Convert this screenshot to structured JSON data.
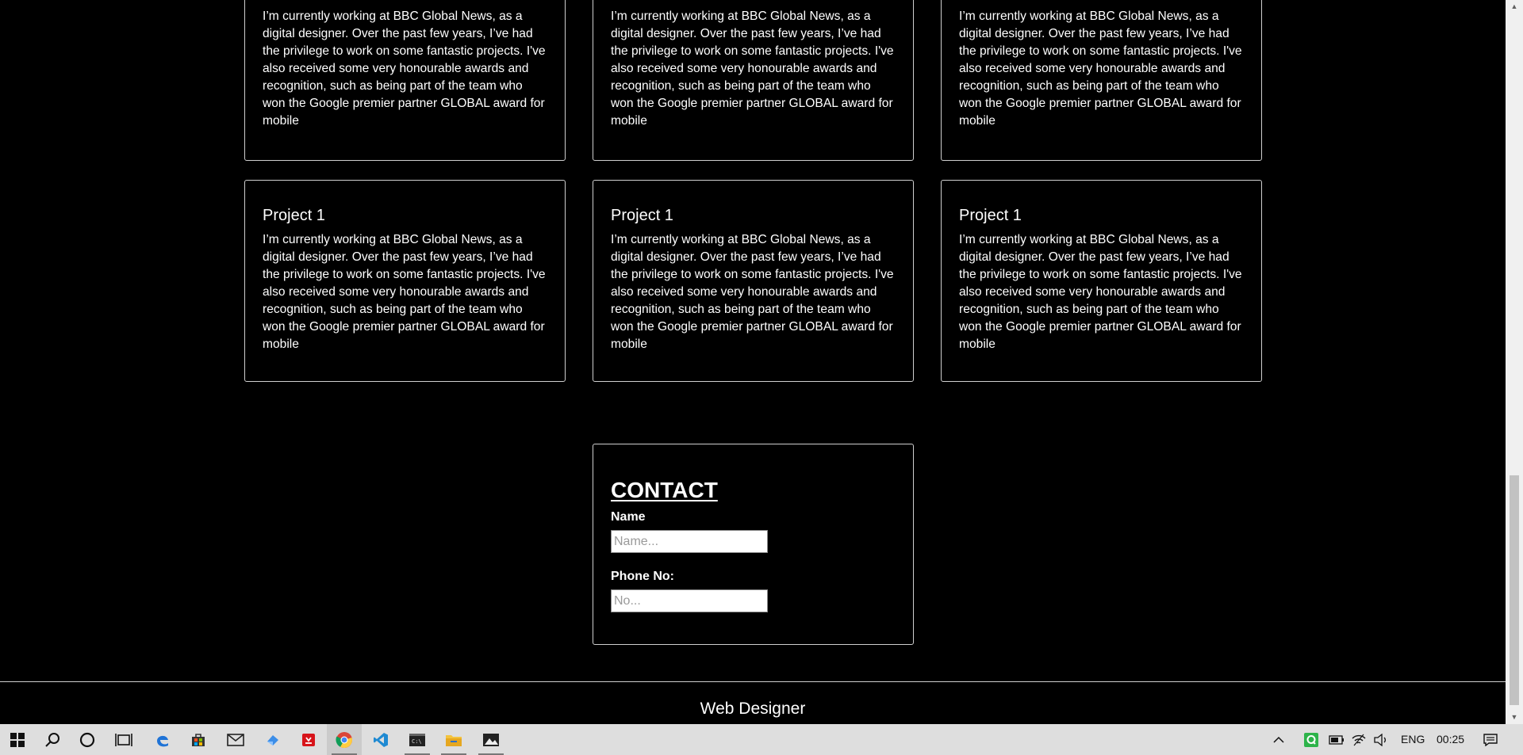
{
  "projects": {
    "row1": [
      {
        "description": "I’m currently working at BBC Global News, as a digital designer. Over the past few years, I’ve had the privilege to work on some fantastic projects. I've also received some very honourable awards and recognition, such as being part of the team who won the Google premier partner GLOBAL award for mobile"
      },
      {
        "description": "I’m currently working at BBC Global News, as a digital designer. Over the past few years, I’ve had the privilege to work on some fantastic projects. I've also received some very honourable awards and recognition, such as being part of the team who won the Google premier partner GLOBAL award for mobile"
      },
      {
        "description": "I’m currently working at BBC Global News, as a digital designer. Over the past few years, I’ve had the privilege to work on some fantastic projects. I've also received some very honourable awards and recognition, such as being part of the team who won the Google premier partner GLOBAL award for mobile"
      }
    ],
    "row2": [
      {
        "title": "Project 1",
        "description": "I’m currently working at BBC Global News, as a digital designer. Over the past few years, I’ve had the privilege to work on some fantastic projects. I've also received some very honourable awards and recognition, such as being part of the team who won the Google premier partner GLOBAL award for mobile"
      },
      {
        "title": "Project 1",
        "description": "I’m currently working at BBC Global News, as a digital designer. Over the past few years, I’ve had the privilege to work on some fantastic projects. I've also received some very honourable awards and recognition, such as being part of the team who won the Google premier partner GLOBAL award for mobile"
      },
      {
        "title": "Project 1",
        "description": "I’m currently working at BBC Global News, as a digital designer. Over the past few years, I’ve had the privilege to work on some fantastic projects. I've also received some very honourable awards and recognition, such as being part of the team who won the Google premier partner GLOBAL award for mobile"
      }
    ]
  },
  "contact": {
    "heading": "CONTACT",
    "name_label": "Name",
    "name_placeholder": "Name...",
    "phone_label": "Phone No:",
    "phone_placeholder": "No..."
  },
  "footer": {
    "text": "Web Designer"
  },
  "taskbar": {
    "apps": [
      "start-icon",
      "search-icon",
      "cortana-icon",
      "task-view-icon",
      "edge-icon",
      "store-icon",
      "mail-icon",
      "app-icon",
      "pdf-icon",
      "chrome-icon",
      "vscode-icon",
      "terminal-icon",
      "file-explorer-icon",
      "photos-icon"
    ],
    "language": "ENG",
    "time": "00:25"
  },
  "colors": {
    "background": "#000000",
    "text": "#ffffff",
    "border": "#cfcfcf",
    "taskbar": "#dedede"
  }
}
